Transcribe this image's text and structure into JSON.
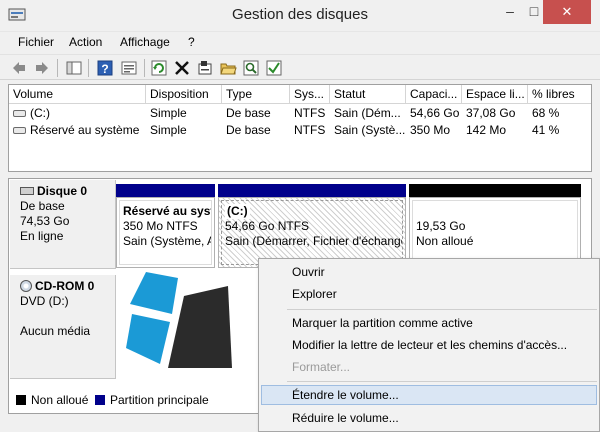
{
  "window": {
    "title": "Gestion des disques",
    "minimize": "–",
    "maximize": "□",
    "close": "✕"
  },
  "menu": [
    "Fichier",
    "Action",
    "Affichage",
    "?"
  ],
  "toolbar_icons": [
    "back-arrow-icon",
    "forward-arrow-icon",
    "console-tree-icon",
    "help-icon",
    "properties-list-icon",
    "refresh-icon",
    "delete-icon",
    "properties-icon",
    "open-folder-icon",
    "search-icon",
    "disk-check-icon"
  ],
  "volumes": {
    "columns": [
      "Volume",
      "Disposition",
      "Type",
      "Sys...",
      "Statut",
      "Capaci...",
      "Espace li...",
      "% libres"
    ],
    "rows": [
      [
        "(C:)",
        "Simple",
        "De base",
        "NTFS",
        "Sain (Dém...",
        "54,66 Go",
        "37,08 Go",
        "68 %"
      ],
      [
        "Réservé au système",
        "Simple",
        "De base",
        "NTFS",
        "Sain (Systè...",
        "350 Mo",
        "142 Mo",
        "41 %"
      ]
    ]
  },
  "disks": [
    {
      "name": "Disque 0",
      "type": "De base",
      "size": "74,53 Go",
      "state": "En ligne",
      "partitions": [
        {
          "name": "Réservé au syst",
          "size": "350 Mo NTFS",
          "status": "Sain (Système, A"
        },
        {
          "name": "(C:)",
          "size": "54,66 Go NTFS",
          "status": "Sain (Démarrer, Fichier d'échange"
        },
        {
          "name": "19,53 Go",
          "size": "Non alloué",
          "status": ""
        }
      ]
    },
    {
      "name": "CD-ROM 0",
      "type": "DVD (D:)",
      "size": "",
      "state": "Aucun média"
    }
  ],
  "legend": {
    "unallocated": "Non alloué",
    "primary": "Partition principale"
  },
  "colors": {
    "primary_partition": "#00008b",
    "unallocated": "#000000",
    "close_button": "#c7504e",
    "menu_highlight": "#dae6f4",
    "logo_blue": "#1b9ad6",
    "logo_dark": "#2b2b2b"
  },
  "context_menu": {
    "items": [
      {
        "label": "Ouvrir",
        "enabled": true
      },
      {
        "label": "Explorer",
        "enabled": true
      },
      {
        "label": "Marquer la partition comme active",
        "enabled": true
      },
      {
        "label": "Modifier la lettre de lecteur et les chemins d'accès...",
        "enabled": true
      },
      {
        "label": "Formater...",
        "enabled": false
      },
      {
        "label": "Étendre le volume...",
        "enabled": true,
        "highlighted": true
      },
      {
        "label": "Réduire le volume...",
        "enabled": true
      }
    ]
  }
}
